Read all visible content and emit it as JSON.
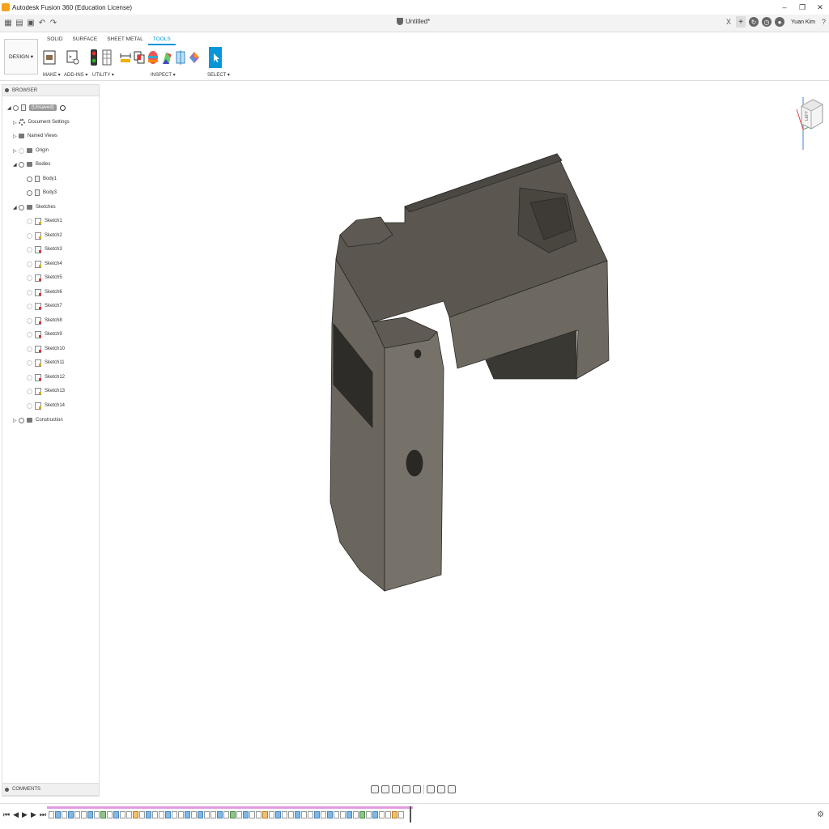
{
  "window": {
    "title": "Autodesk Fusion 360 (Education License)",
    "minimize": "–",
    "restore": "❐",
    "close": "✕"
  },
  "tabrow": {
    "document_title": "Untitled*",
    "close_tab": "X",
    "user": "Yuan Kim",
    "help": "?"
  },
  "toolbar": {
    "design_label": "DESIGN ▾",
    "tabs": [
      "SOLID",
      "SURFACE",
      "SHEET METAL",
      "TOOLS"
    ],
    "active_tab": "TOOLS",
    "groups": {
      "make": "MAKE ▾",
      "addins": "ADD-INS ▾",
      "utility": "UTILITY ▾",
      "inspect": "INSPECT ▾",
      "select": "SELECT ▾"
    }
  },
  "browser": {
    "title": "BROWSER",
    "root": "(Unsaved)",
    "items": {
      "document_settings": "Document Settings",
      "named_views": "Named Views",
      "origin": "Origin",
      "bodies": "Bodies",
      "body1": "Body1",
      "body3": "Body3",
      "sketches": "Sketches",
      "construction": "Construction"
    },
    "sketches": [
      "Sketch1",
      "Sketch2",
      "Sketch3",
      "Sketch4",
      "Sketch5",
      "Sketch6",
      "Sketch7",
      "Sketch8",
      "Sketch9",
      "Sketch10",
      "Sketch11",
      "Sketch12",
      "Sketch13",
      "Sketch14"
    ]
  },
  "comments": {
    "title": "COMMENTS"
  },
  "viewcube": {
    "face": "LEFT"
  },
  "timeline": {
    "controls": [
      "⏮",
      "◀",
      "▶",
      "▶",
      "⏭"
    ],
    "settings": "⚙"
  },
  "colors": {
    "accent": "#0696d7",
    "model_top": "#5a5650",
    "model_side": "#6e6a62",
    "model_dark": "#3f3c37"
  }
}
